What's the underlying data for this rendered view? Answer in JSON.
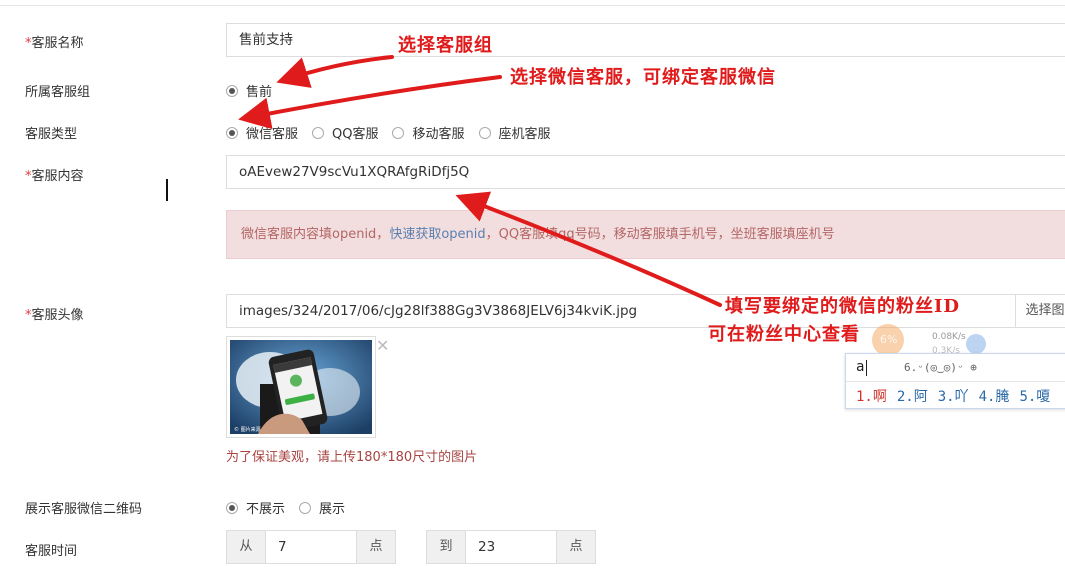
{
  "form": {
    "name": {
      "label": "客服名称",
      "value": "售前支持"
    },
    "group": {
      "label": "所属客服组",
      "option": "售前"
    },
    "type": {
      "label": "客服类型",
      "options": [
        "微信客服",
        "QQ客服",
        "移动客服",
        "座机客服"
      ]
    },
    "content": {
      "label": "客服内容",
      "value": "oAEvew27V9scVu1XQRAfgRiDfj5Q",
      "alert_text_1": "微信客服内容填openid，",
      "alert_link": "快速获取openid",
      "alert_text_2": "，QQ客服填qq号码，移动客服填手机号，坐班客服填座机号"
    },
    "avatar": {
      "label": "客服头像",
      "value": "images/324/2017/06/cJg28lf388Gg3V3868JELV6j34kviK.jpg",
      "button": "选择图",
      "help": "为了保证美观，请上传180*180尺寸的图片"
    },
    "qrcode": {
      "label": "展示客服微信二维码",
      "options": [
        "不展示",
        "展示"
      ]
    },
    "time": {
      "label": "客服时间",
      "from_label": "从",
      "from_value": "7",
      "from_unit": "点",
      "to_label": "到",
      "to_value": "23",
      "to_unit": "点"
    },
    "required_mark": "*"
  },
  "annotations": {
    "note1": "选择客服组",
    "note2": "选择微信客服，可绑定客服微信",
    "note3_line1": "填写要绑定的微信的粉丝ID",
    "note3_line2": "可在粉丝中心查看"
  },
  "ime": {
    "input": "a",
    "hint": "6.ᵕ(◎‿◎)ᵕ  ⊕",
    "candidates": [
      "1.啊",
      "2.阿",
      "3.吖",
      "4.腌",
      "5.嗄"
    ]
  },
  "speed_widget": {
    "up": "0.08K/s",
    "down": "0.3K/s",
    "percent": "6%"
  },
  "colors": {
    "annotation": "#e01b1b",
    "alert_bg": "#f2dede",
    "alert_text": "#b46667",
    "link": "#5b7fb0"
  }
}
